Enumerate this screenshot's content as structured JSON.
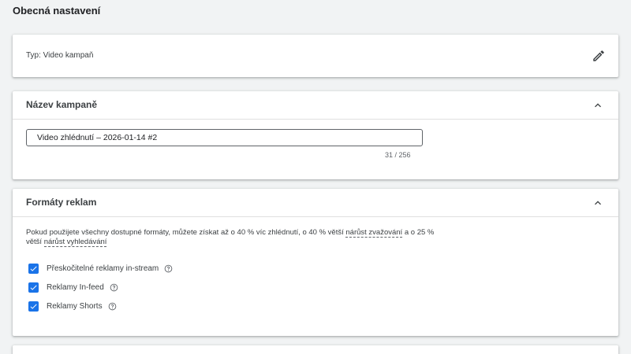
{
  "page": {
    "section_title": "Obecná nastavení"
  },
  "type_card": {
    "label": "Typ: Video kampaň",
    "edit_icon": "pencil-icon"
  },
  "name_card": {
    "title": "Název kampaně",
    "input_value": "Video zhlédnutí – 2026-01-14 #2",
    "counter": "31 / 256",
    "collapse_icon": "chevron-up-icon"
  },
  "formats_card": {
    "title": "Formáty reklam",
    "collapse_icon": "chevron-up-icon",
    "desc_part1": "Pokud použijete všechny dostupné formáty, můžete získat až o 40 % víc zhlédnutí, o 40 % větší ",
    "desc_link1": "nárůst zvažování",
    "desc_part2": " a o 25 % větší ",
    "desc_link2": "nárůst vyhledávání",
    "options": [
      {
        "label": "Přeskočitelné reklamy in-stream",
        "checked": true
      },
      {
        "label": "Reklamy In-feed",
        "checked": true
      },
      {
        "label": "Reklamy Shorts",
        "checked": true
      }
    ]
  },
  "colors": {
    "accent": "#1a73e8",
    "background": "#f1f3f4"
  }
}
